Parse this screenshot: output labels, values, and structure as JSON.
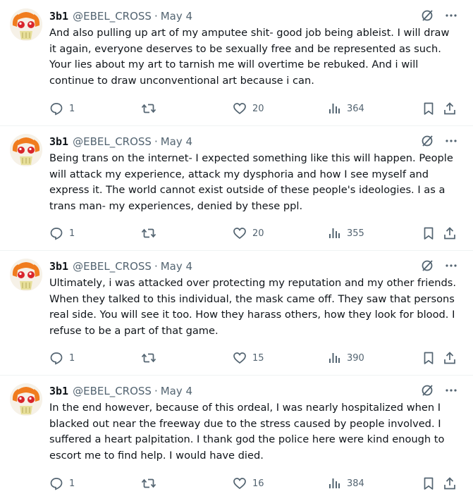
{
  "tweets": [
    {
      "display_name": "3b1",
      "handle": "@EBEL_CROSS",
      "separator": "·",
      "date": "May 4",
      "text": "And also pulling up art of my amputee shit- good job being ableist. I will draw it again, everyone deserves to be sexually free and be represented as such. Your lies about my art to tarnish me will overtime be rebuked. And i will continue to draw unconventional art because i can.",
      "replies": "1",
      "retweets": "",
      "likes": "20",
      "views": "364"
    },
    {
      "display_name": "3b1",
      "handle": "@EBEL_CROSS",
      "separator": "·",
      "date": "May 4",
      "text": "Being trans on the internet- I expected something like this will happen. People will attack my experience, attack my dysphoria and how I see myself and express it. The world cannot exist outside of these people's ideologies. I as a trans man- my experiences, denied by these ppl.",
      "replies": "1",
      "retweets": "",
      "likes": "20",
      "views": "355"
    },
    {
      "display_name": "3b1",
      "handle": "@EBEL_CROSS",
      "separator": "·",
      "date": "May 4",
      "text": "Ultimately, i was attacked over protecting my reputation and my other friends. When they talked to this individual, the mask came off. They saw that persons real side. You will see it too. How they harass others, how they look for blood. I refuse to be a part of that game.",
      "replies": "1",
      "retweets": "",
      "likes": "15",
      "views": "390"
    },
    {
      "display_name": "3b1",
      "handle": "@EBEL_CROSS",
      "separator": "·",
      "date": "May 4",
      "text": "In the end however, because of this ordeal, I was nearly hospitalized when I blacked out near the freeway due to the stress caused by people involved. I suffered a heart palpitation. I thank god the police here were kind enough to escort me to find help. I would have died.",
      "replies": "1",
      "retweets": "",
      "likes": "16",
      "views": "384"
    }
  ],
  "icons": {
    "avatar": "avatar-icon",
    "grok": "grok-icon",
    "more": "more-icon",
    "reply": "reply-icon",
    "retweet": "retweet-icon",
    "like": "heart-icon",
    "views": "views-icon",
    "bookmark": "bookmark-icon",
    "share": "share-icon"
  },
  "colors": {
    "text": "#0f1419",
    "secondary": "#536471",
    "divider": "#eff3f4",
    "avatar_orange": "#f07c1e"
  }
}
